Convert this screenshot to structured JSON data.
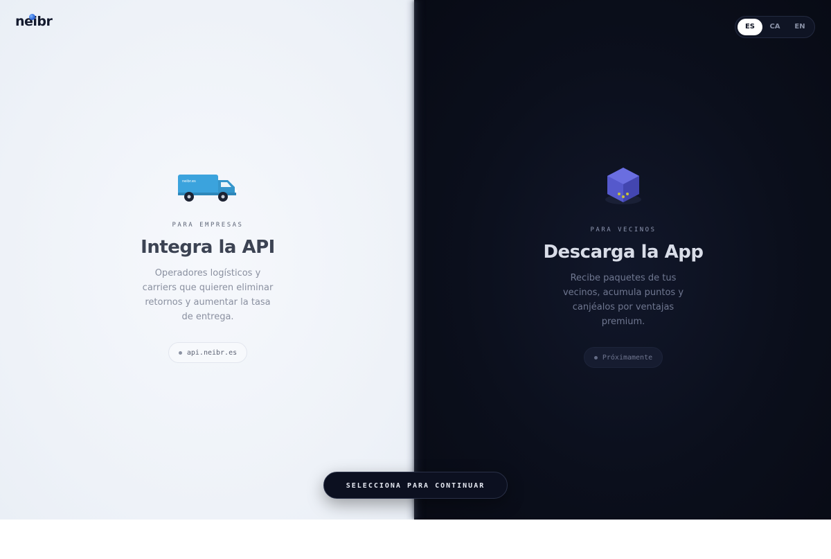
{
  "brand": {
    "logo_text": "neibr"
  },
  "language": {
    "options": [
      "ES",
      "CA",
      "EN"
    ],
    "selected": "ES"
  },
  "business": {
    "truck_label": "neibr.es",
    "eyebrow": "PARA EMPRESAS",
    "title": "Integra la API",
    "description": "Operadores logísticos y carriers que quieren eliminar retornos y aumentar la tasa de entrega.",
    "link_label": "api.neibr.es"
  },
  "neighbors": {
    "eyebrow": "PARA VECINOS",
    "title": "Descarga la App",
    "description": "Recibe paquetes de tus vecinos, acumula puntos y canjéalos por ventajas premium.",
    "status_label": "Próximamente"
  },
  "cta": {
    "label": "SELECCIONA PARA CONTINUAR"
  },
  "colors": {
    "light_panel": "#eef2f8",
    "dark_panel": "#0b0f1c",
    "truck_body": "#3ba3dd",
    "cube_face": "#5b5fd6",
    "cube_dots": "#c6c23a"
  }
}
